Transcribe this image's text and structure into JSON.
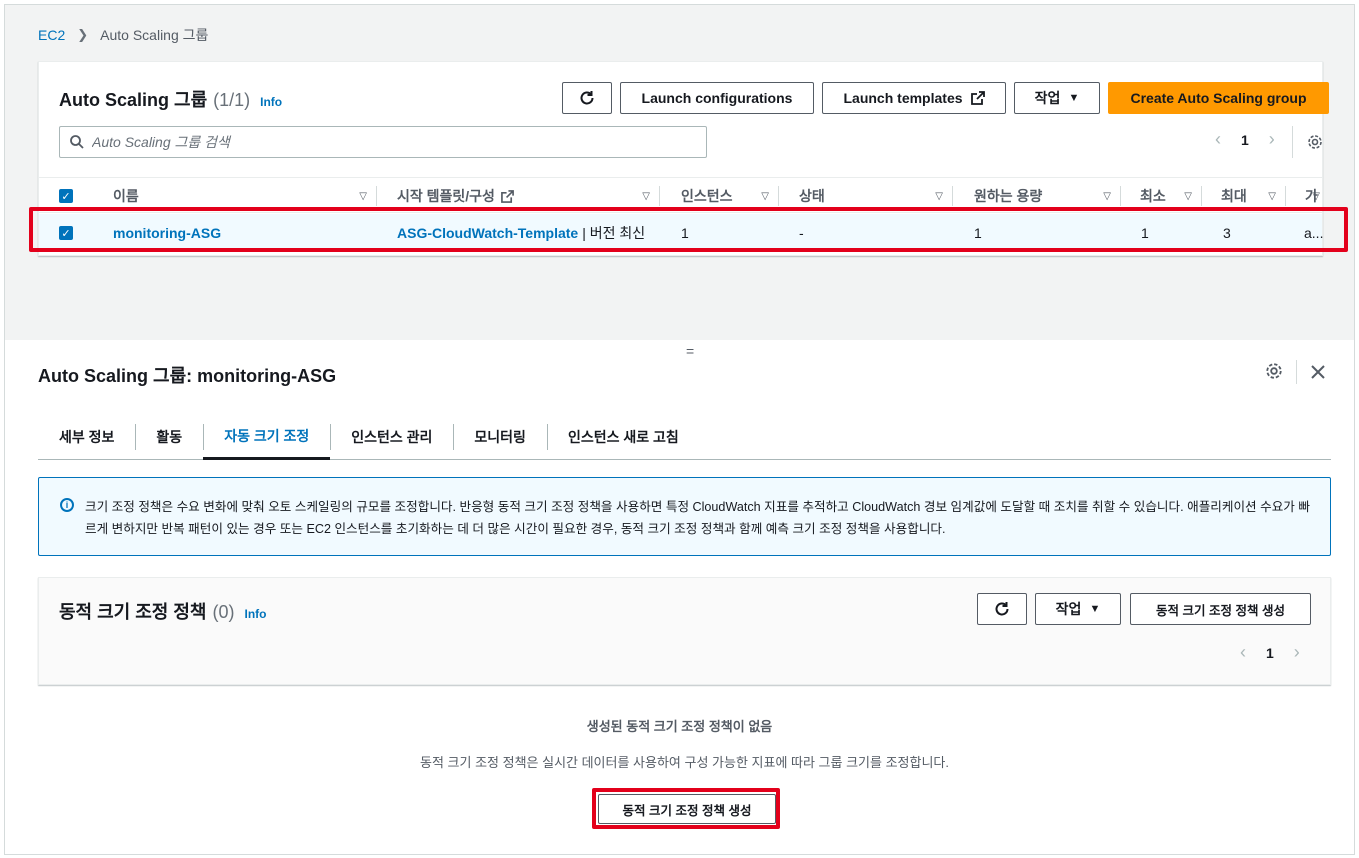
{
  "breadcrumb": {
    "root": "EC2",
    "current": "Auto Scaling 그룹"
  },
  "asg_panel": {
    "title": "Auto Scaling 그룹",
    "count": "(1/1)",
    "info": "Info",
    "launch_configurations": "Launch configurations",
    "launch_templates": "Launch templates",
    "actions": "작업",
    "create_button": "Create Auto Scaling group",
    "search_placeholder": "Auto Scaling 그룹 검색",
    "page": "1",
    "columns": [
      "이름",
      "시작 템플릿/구성",
      "인스턴스",
      "상태",
      "원하는 용량",
      "최소",
      "최대",
      "가"
    ],
    "row": {
      "name": "monitoring-ASG",
      "template": "ASG-CloudWatch-Template",
      "template_suffix": "| 버전 최신",
      "instances": "1",
      "status": "-",
      "desired": "1",
      "min": "1",
      "max": "3",
      "az": "a..."
    }
  },
  "splitter": "=",
  "detail": {
    "title": "Auto Scaling 그룹: monitoring-ASG",
    "tabs": [
      "세부 정보",
      "활동",
      "자동 크기 조정",
      "인스턴스 관리",
      "모니터링",
      "인스턴스 새로 고침"
    ],
    "active_tab": "자동 크기 조정",
    "alert_text": "크기 조정 정책은 수요 변화에 맞춰 오토 스케일링의 규모를 조정합니다. 반응형 동적 크기 조정 정책을 사용하면 특정 CloudWatch 지표를 추적하고 CloudWatch 경보 임계값에 도달할 때 조치를 취할 수 있습니다. 애플리케이션 수요가 빠르게 변하지만 반복 패턴이 있는 경우 또는 EC2 인스턴스를 초기화하는 데 더 많은 시간이 필요한 경우, 동적 크기 조정 정책과 함께 예측 크기 조정 정책을 사용합니다.",
    "policy_title": "동적 크기 조정 정책",
    "policy_count": "(0)",
    "policy_info": "Info",
    "policy_actions": "작업",
    "policy_create": "동적 크기 조정 정책 생성",
    "policy_page": "1",
    "empty_title": "생성된 동적 크기 조정 정책이 없음",
    "empty_desc": "동적 크기 조정 정책은 실시간 데이터를 사용하여 구성 가능한 지표에 따라 그룹 크기를 조정합니다.",
    "empty_button": "동적 크기 조정 정책 생성"
  },
  "colors": {
    "link": "#0073bb",
    "primary": "#ff9900",
    "highlight": "#e3001b"
  }
}
